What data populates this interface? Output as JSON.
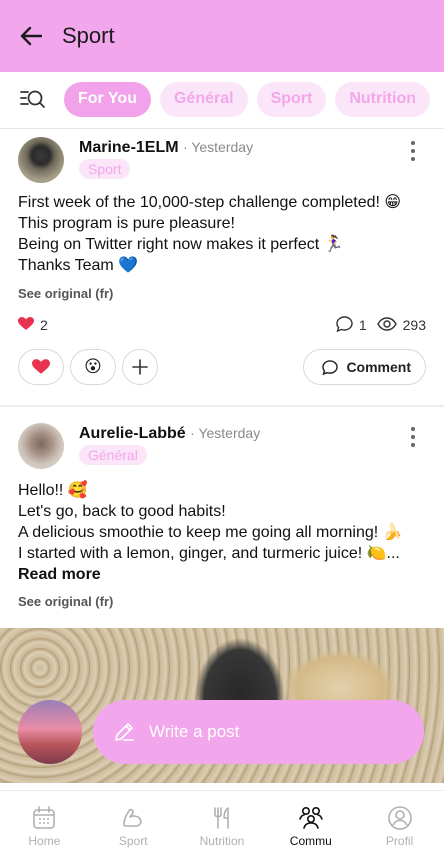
{
  "header": {
    "title": "Sport"
  },
  "filters": [
    {
      "label": "For You",
      "active": true
    },
    {
      "label": "Général",
      "active": false
    },
    {
      "label": "Sport",
      "active": false
    },
    {
      "label": "Nutrition",
      "active": false
    }
  ],
  "posts": [
    {
      "author": "Marine-1ELM",
      "time": "· Yesterday",
      "tag": "Sport",
      "lines": [
        "First week of the 10,000-step challenge completed! 😁",
        "This program is pure pleasure!",
        "Being on Twitter right now makes it perfect 🏃‍♀️",
        "Thanks Team 💙"
      ],
      "see_original": "See original (fr)",
      "likes": "2",
      "comments": "1",
      "views": "293",
      "comment_label": "Comment"
    },
    {
      "author": "Aurelie-Labbé",
      "time": "· Yesterday",
      "tag": "Général",
      "lines": [
        "Hello!! 🥰",
        "Let's go, back to good habits!",
        "A delicious smoothie to keep me going all morning! 🍌",
        "I started with a lemon, ginger, and turmeric juice! 🍋..."
      ],
      "read_more": "Read more",
      "see_original": "See original (fr)"
    }
  ],
  "compose": {
    "placeholder": "Write a post"
  },
  "nav": [
    {
      "label": "Home",
      "icon": "calendar-icon",
      "active": false
    },
    {
      "label": "Sport",
      "icon": "muscle-icon",
      "active": false
    },
    {
      "label": "Nutrition",
      "icon": "utensils-icon",
      "active": false
    },
    {
      "label": "Commu",
      "icon": "community-icon",
      "active": true
    },
    {
      "label": "Profil",
      "icon": "profile-icon",
      "active": false
    }
  ],
  "colors": {
    "accent": "#f2a6ec",
    "chip_bg": "#fbe6f9"
  }
}
